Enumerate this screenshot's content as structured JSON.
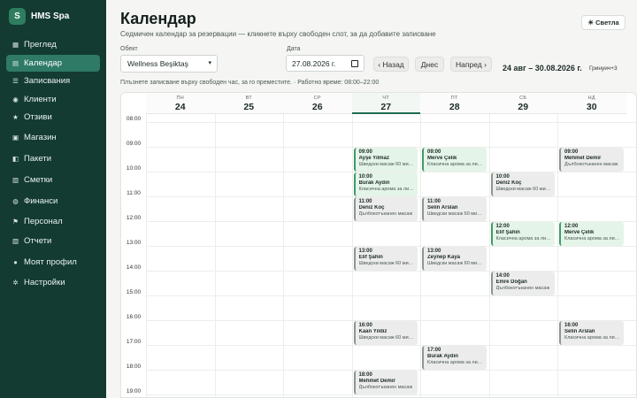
{
  "brand": {
    "logo_letter": "S",
    "name": "HMS Spa"
  },
  "nav": [
    {
      "icon": "layout-icon",
      "glyph": "▦",
      "label": "Преглед",
      "active": false
    },
    {
      "icon": "calendar-icon",
      "glyph": "▤",
      "label": "Календар",
      "active": true
    },
    {
      "icon": "list-icon",
      "glyph": "☰",
      "label": "Записвания",
      "active": false
    },
    {
      "icon": "clients-icon",
      "glyph": "◉",
      "label": "Клиенти",
      "active": false
    },
    {
      "icon": "star-icon",
      "glyph": "★",
      "label": "Отзиви",
      "active": false
    },
    {
      "icon": "shop-icon",
      "glyph": "▣",
      "label": "Магазин",
      "active": false
    },
    {
      "icon": "package-icon",
      "glyph": "◧",
      "label": "Пакети",
      "active": false
    },
    {
      "icon": "invoice-icon",
      "glyph": "▥",
      "label": "Сметки",
      "active": false
    },
    {
      "icon": "money-icon",
      "glyph": "◍",
      "label": "Финанси",
      "active": false
    },
    {
      "icon": "flag-icon",
      "glyph": "⚑",
      "label": "Персонал",
      "active": false
    },
    {
      "icon": "reports-icon",
      "glyph": "▧",
      "label": "Отчети",
      "active": false
    },
    {
      "icon": "user-icon",
      "glyph": "●",
      "label": "Моят профил",
      "active": false
    },
    {
      "icon": "gear-icon",
      "glyph": "✲",
      "label": "Настройки",
      "active": false
    }
  ],
  "header": {
    "title": "Календар",
    "subtitle": "Седмичен календар за резервации — кликнете върху свободен слот, за да добавите записване",
    "theme_button": "☀ Светла"
  },
  "filters": {
    "location_label": "Обект",
    "location_value": "Wellness Beşiktaş",
    "date_label": "Дата",
    "date_value": "27.08.2026 г.",
    "prev_label": "‹ Назад",
    "today_label": "Днес",
    "next_label": "Напред ›",
    "range": "24 авг – 30.08.2026 г.",
    "timezone": "Гринуич+3"
  },
  "hint": "Плъзнете записване върху свободен час, за го преместите. · Работно време: 08:00–22:00",
  "calendar": {
    "days": [
      {
        "dow": "ПН",
        "num": "24",
        "today": false
      },
      {
        "dow": "ВТ",
        "num": "25",
        "today": false
      },
      {
        "dow": "СР",
        "num": "26",
        "today": false
      },
      {
        "dow": "ЧТ",
        "num": "27",
        "today": true
      },
      {
        "dow": "ПТ",
        "num": "28",
        "today": false
      },
      {
        "dow": "СБ",
        "num": "29",
        "today": false
      },
      {
        "dow": "НД",
        "num": "30",
        "today": false
      }
    ],
    "hours": [
      "08:00",
      "09:00",
      "10:00",
      "11:00",
      "12:00",
      "13:00",
      "14:00",
      "15:00",
      "16:00",
      "17:00",
      "18:00",
      "19:00"
    ],
    "events": [
      {
        "day": 3,
        "start": 9,
        "time": "09:00",
        "name": "Ayşe Yilmaz",
        "service": "Шведски масаж 60 минути",
        "green": true
      },
      {
        "day": 3,
        "start": 10,
        "time": "10:00",
        "name": "Burak Aydın",
        "service": "Класична арома за лице",
        "green": true
      },
      {
        "day": 3,
        "start": 11,
        "time": "11:00",
        "name": "Deniz Koç",
        "service": "Дълбокотъканен масаж",
        "green": false
      },
      {
        "day": 3,
        "start": 13,
        "time": "13:00",
        "name": "Elif Şahin",
        "service": "Шведски масаж 60 минути",
        "green": false
      },
      {
        "day": 3,
        "start": 16,
        "time": "16:00",
        "name": "Kaan Yıldız",
        "service": "Шведски масаж 60 минути",
        "green": false
      },
      {
        "day": 3,
        "start": 18,
        "time": "18:00",
        "name": "Mehmet Demir",
        "service": "Дълбокотъканен масаж",
        "green": false
      },
      {
        "day": 4,
        "start": 9,
        "time": "09:00",
        "name": "Merve Çelik",
        "service": "Класична арома за лице",
        "green": true
      },
      {
        "day": 4,
        "start": 11,
        "time": "11:00",
        "name": "Selin Arslan",
        "service": "Шведски масаж 60 минути",
        "green": false
      },
      {
        "day": 4,
        "start": 13,
        "time": "13:00",
        "name": "Zeynep Kaya",
        "service": "Шведски масаж 60 минути",
        "green": false
      },
      {
        "day": 4,
        "start": 17,
        "time": "17:00",
        "name": "Burak Aydın",
        "service": "Класична арома за лице",
        "green": false
      },
      {
        "day": 5,
        "start": 10,
        "time": "10:00",
        "name": "Deniz Koç",
        "service": "Шведски масаж 60 минути",
        "green": false
      },
      {
        "day": 5,
        "start": 12,
        "time": "12:00",
        "name": "Elif Şahin",
        "service": "Класична арома за лице",
        "green": true
      },
      {
        "day": 5,
        "start": 14,
        "time": "14:00",
        "name": "Emre Doğan",
        "service": "Дълбокотъканен масаж",
        "green": false
      },
      {
        "day": 6,
        "start": 9,
        "time": "09:00",
        "name": "Mehmet Demir",
        "service": "Дълбокотъканен масаж",
        "green": false
      },
      {
        "day": 6,
        "start": 12,
        "time": "12:00",
        "name": "Merve Çelik",
        "service": "Класична арома за лице",
        "green": true
      },
      {
        "day": 6,
        "start": 16,
        "time": "16:00",
        "name": "Selin Arslan",
        "service": "Класична арома за лице",
        "green": false
      }
    ]
  }
}
